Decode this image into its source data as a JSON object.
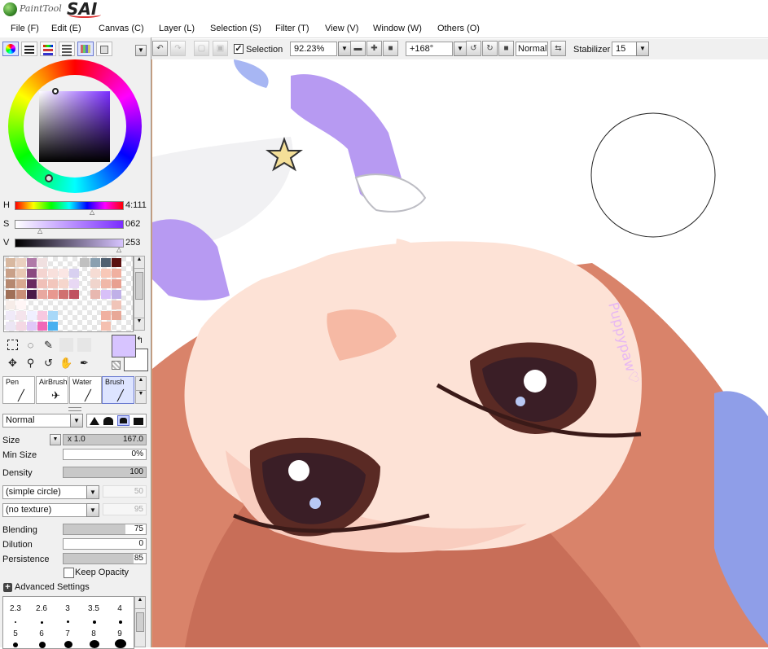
{
  "app": {
    "logo_small": "PaintTool",
    "logo_big": "SAI"
  },
  "menu": [
    "File (F)",
    "Edit (E)",
    "Canvas (C)",
    "Layer (L)",
    "Selection (S)",
    "Filter (T)",
    "View (V)",
    "Window (W)",
    "Others (O)"
  ],
  "toolbar": {
    "selection_label": "Selection",
    "selection_checked": true,
    "zoom": "92.23%",
    "rotation": "+168°",
    "blend": "Normal",
    "stabilizer_label": "Stabilizer",
    "stabilizer_value": "15"
  },
  "color": {
    "hue_label": "H",
    "hue_value": "4:111",
    "sat_label": "S",
    "sat_value": "062",
    "val_label": "V",
    "val_value": "253",
    "primary": "#d7c4ff",
    "secondary": "#ffffff"
  },
  "brushes": [
    {
      "label": "Pen",
      "selected": false
    },
    {
      "label": "AirBrush",
      "selected": false
    },
    {
      "label": "Water",
      "selected": false
    },
    {
      "label": "Brush",
      "selected": true
    }
  ],
  "brush_mode": "Normal",
  "props": {
    "size_label": "Size",
    "size_mult": "x 1.0",
    "size_value": "167.0",
    "min_size_label": "Min Size",
    "min_size_value": "0%",
    "density_label": "Density",
    "density_value": "100",
    "shape": "(simple circle)",
    "shape_value": "50",
    "texture": "(no texture)",
    "texture_value": "95",
    "blending_label": "Blending",
    "blending_value": "75",
    "dilution_label": "Dilution",
    "dilution_value": "0",
    "persistence_label": "Persistence",
    "persistence_value": "85",
    "keep_opacity_label": "Keep Opacity",
    "advanced_label": "Advanced Settings"
  },
  "brush_sizes": [
    "2.3",
    "2.6",
    "3",
    "3.5",
    "4",
    "5",
    "6",
    "7",
    "8",
    "9"
  ],
  "watermark": "Puppypaw♡"
}
